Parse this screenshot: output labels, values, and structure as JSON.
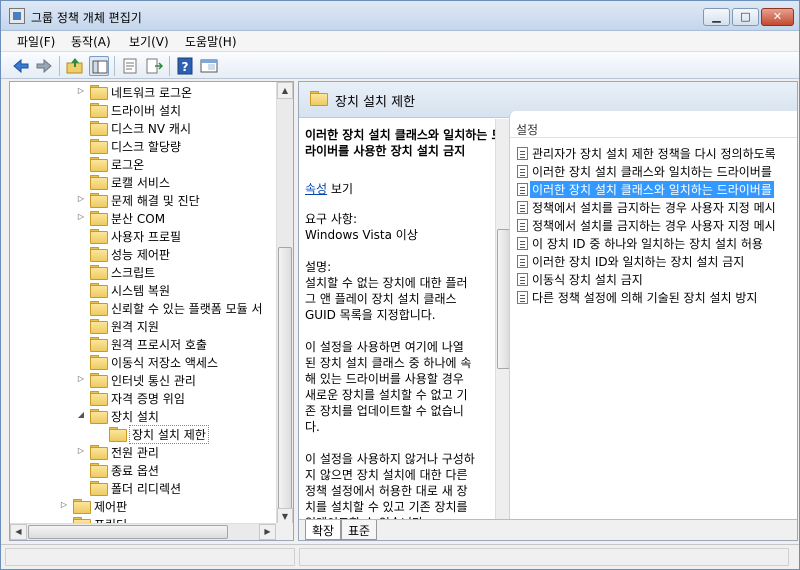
{
  "window": {
    "title": "그룹 정책 개체 편집기"
  },
  "menubar": [
    {
      "label": "파일(F)"
    },
    {
      "label": "동작(A)"
    },
    {
      "label": "보기(V)"
    },
    {
      "label": "도움말(H)"
    }
  ],
  "toolbar": {
    "icons": [
      "back-icon",
      "forward-icon",
      "up-folder-icon",
      "show-hide-tree-icon",
      "properties-icon",
      "export-list-icon",
      "help-icon",
      "extended-view-icon"
    ]
  },
  "tree": {
    "items": [
      {
        "label": "네트워크 로그온",
        "expandable": true
      },
      {
        "label": "드라이버 설치",
        "expandable": false
      },
      {
        "label": "디스크 NV 캐시",
        "expandable": false
      },
      {
        "label": "디스크 할당량",
        "expandable": false
      },
      {
        "label": "로그온",
        "expandable": false
      },
      {
        "label": "로캘 서비스",
        "expandable": false
      },
      {
        "label": "문제 해결 및 진단",
        "expandable": true
      },
      {
        "label": "분산 COM",
        "expandable": true
      },
      {
        "label": "사용자 프로필",
        "expandable": false
      },
      {
        "label": "성능 제어판",
        "expandable": false
      },
      {
        "label": "스크립트",
        "expandable": false
      },
      {
        "label": "시스템 복원",
        "expandable": false
      },
      {
        "label": "신뢰할 수 있는 플랫폼 모듈 서",
        "expandable": false
      },
      {
        "label": "원격 지원",
        "expandable": false
      },
      {
        "label": "원격 프로시저 호출",
        "expandable": false
      },
      {
        "label": "이동식 저장소 액세스",
        "expandable": false
      },
      {
        "label": "인터넷 통신 관리",
        "expandable": true
      },
      {
        "label": "자격 증명 위임",
        "expandable": false
      },
      {
        "label": "장치 설치",
        "expandable": true,
        "expanded": true
      },
      {
        "label": "장치 설치 제한",
        "expandable": false,
        "selected": true,
        "child": true
      },
      {
        "label": "전원 관리",
        "expandable": true
      },
      {
        "label": "종료 옵션",
        "expandable": false
      },
      {
        "label": "폴더 리디렉션",
        "expandable": false
      },
      {
        "label": "제어판",
        "expandable": true,
        "level_up": true
      },
      {
        "label": "프린터",
        "expandable": false,
        "level_up": true
      }
    ]
  },
  "right_pane": {
    "header_title": "장치 설치 제한",
    "description": {
      "title": "이러한 장치 설치 클래스와 일치하는 드라이버를 사용한 장치 설치 금지",
      "link_text": "속성",
      "link_suffix": "보기",
      "requirements_label": "요구 사항:",
      "requirements_value": "Windows Vista 이상",
      "explain_label": "설명:",
      "lines": [
        "설치할 수 없는 장치에 대한 플러",
        "그 앤 플레이 장치 설치 클래스",
        "GUID 목록을 지정합니다.",
        "",
        "이 설정을 사용하면 여기에 나열",
        "된 장치 설치 클래스 중 하나에 속",
        "해 있는 드라이버를 사용할 경우",
        "새로운 장치를 설치할 수 없고 기",
        "존 장치를 업데이트할 수 없습니",
        "다.",
        "",
        "이 설정을 사용하지 않거나 구성하",
        "지 않으면 장치 설치에 대한 다른",
        "정책 설정에서 허용한 대로 새 장",
        "치를 설치할 수 있고 기존 장치를",
        "업데이트할 수 있습니다."
      ]
    },
    "settings": {
      "column_header": "설정",
      "items": [
        {
          "label": "관리자가 장치 설치 제한 정책을 다시 정의하도록"
        },
        {
          "label": "이러한 장치 설치 클래스와 일치하는 드라이버를"
        },
        {
          "label": "이러한 장치 설치 클래스와 일치하는 드라이버를",
          "selected": true
        },
        {
          "label": "정책에서 설치를 금지하는 경우 사용자 지정 메시"
        },
        {
          "label": "정책에서 설치를 금지하는 경우 사용자 지정 메시"
        },
        {
          "label": "이 장치 ID 중 하나와 일치하는 장치 설치 허용"
        },
        {
          "label": "이러한 장치 ID와 일치하는 장치 설치 금지"
        },
        {
          "label": "이동식 장치 설치 금지"
        },
        {
          "label": "다른 정책 설정에 의해 기술된 장치 설치 방지"
        }
      ]
    },
    "tabs": [
      {
        "label": "확장",
        "active": true
      },
      {
        "label": "표준",
        "active": false
      }
    ]
  },
  "colors": {
    "selection": "#3399ff",
    "link": "#0645ad",
    "folder": "#eecb62"
  }
}
